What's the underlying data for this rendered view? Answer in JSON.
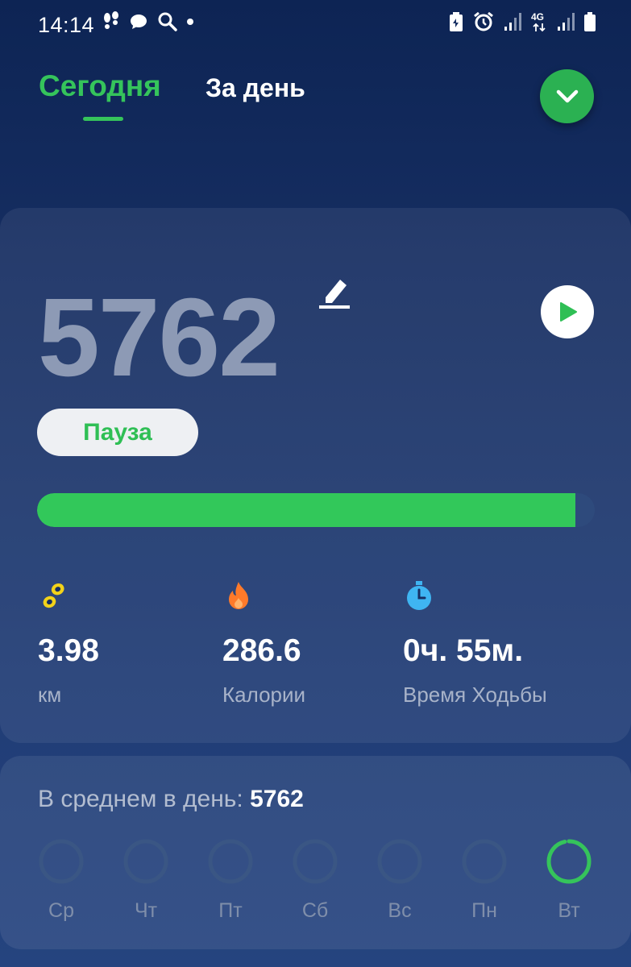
{
  "status_bar": {
    "time": "14:14",
    "network": "4G"
  },
  "tabs": [
    {
      "label": "Сегодня",
      "active": true
    },
    {
      "label": "За день",
      "active": false
    }
  ],
  "colors": {
    "accent": "#35c45b",
    "calories": "#ff7a2a",
    "distance": "#f2d21a",
    "time": "#3fb5f2"
  },
  "today": {
    "steps": "5762",
    "pause_label": "Пауза",
    "goal_progress": 0.965
  },
  "stats": [
    {
      "icon": "footprints-icon",
      "value": "3.98",
      "label": "км"
    },
    {
      "icon": "flame-icon",
      "value": "286.6",
      "label": "Калории"
    },
    {
      "icon": "stopwatch-icon",
      "value": "0ч. 55м.",
      "label": "Время Ходьбы"
    }
  ],
  "weekly": {
    "avg_label": "В среднем в день: ",
    "avg_value": "5762",
    "days": [
      {
        "label": "Ср",
        "progress": 0
      },
      {
        "label": "Чт",
        "progress": 0
      },
      {
        "label": "Пт",
        "progress": 0
      },
      {
        "label": "Сб",
        "progress": 0
      },
      {
        "label": "Вс",
        "progress": 0
      },
      {
        "label": "Пн",
        "progress": 0
      },
      {
        "label": "Вт",
        "progress": 0.965
      }
    ]
  }
}
